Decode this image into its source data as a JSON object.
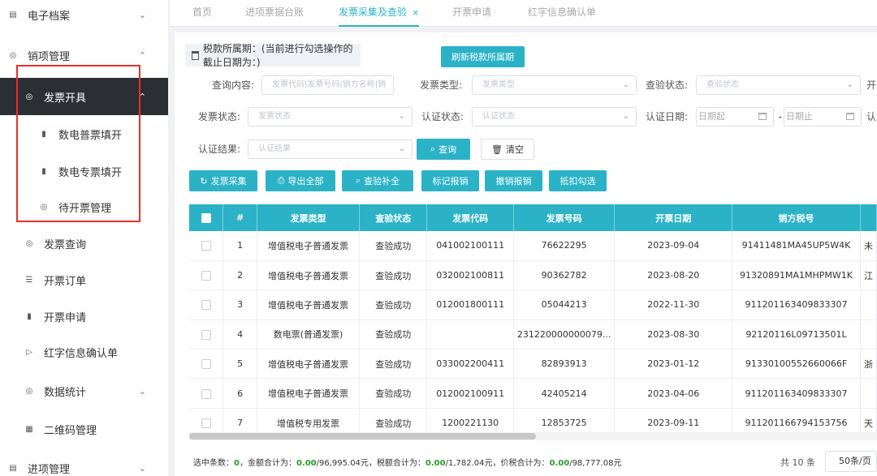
{
  "sidebar": {
    "items": [
      {
        "label": "电子档案",
        "icon": "document-icon",
        "chevron": "⌄"
      },
      {
        "label": "销项管理",
        "icon": "shield-check-icon",
        "chevron": "⌃"
      },
      {
        "label": "发票开具",
        "icon": "shield-check-icon",
        "chevron": "⌃"
      },
      {
        "label": "数电普票填开",
        "icon": "bar-chart-icon",
        "chevron": ""
      },
      {
        "label": "数电专票填开",
        "icon": "bar-chart-icon",
        "chevron": ""
      },
      {
        "label": "待开票管理",
        "icon": "shield-check-icon",
        "chevron": ""
      },
      {
        "label": "发票查询",
        "icon": "shield-check-icon",
        "chevron": ""
      },
      {
        "label": "开票订单",
        "icon": "list-icon",
        "chevron": ""
      },
      {
        "label": "开票申请",
        "icon": "bar-chart-icon",
        "chevron": ""
      },
      {
        "label": "红字信息确认单",
        "icon": "send-icon",
        "chevron": ""
      },
      {
        "label": "数据统计",
        "icon": "shield-check-icon",
        "chevron": "⌄"
      },
      {
        "label": "二维码管理",
        "icon": "qr-code-icon",
        "chevron": ""
      },
      {
        "label": "进项管理",
        "icon": "document-icon",
        "chevron": "⌄"
      }
    ]
  },
  "tabs": [
    {
      "label": "首页"
    },
    {
      "label": "进项票据台账"
    },
    {
      "label": "发票采集及查验",
      "close": "×"
    },
    {
      "label": "开票申请"
    },
    {
      "label": "红字信息确认单"
    }
  ],
  "tax_period": {
    "label": "税款所属期：(当前进行勾选操作的截止日期为：)",
    "refresh_button": "刷新税款所属期"
  },
  "filters": {
    "query_label": "查询内容:",
    "query_placeholder": "发票代码|发票号码|销方名称|销",
    "invoice_type_label": "发票类型:",
    "invoice_type_placeholder": "发票类型",
    "check_status_label": "查验状态:",
    "check_status_placeholder": "查验状态",
    "extra_label_1": "开",
    "invoice_status_label": "发票状态:",
    "invoice_status_placeholder": "发票状态",
    "cert_status_label": "认证状态:",
    "cert_status_placeholder": "认证状态",
    "cert_date_label": "认证日期:",
    "date_start_placeholder": "日期起",
    "date_sep": "-",
    "date_end_placeholder": "日期止",
    "extra_label_2": "认",
    "cert_result_label": "认证结果:",
    "cert_result_placeholder": "认证结果",
    "search_button": "查询",
    "clear_button": "清空"
  },
  "toolbar": {
    "collect": "发票采集",
    "export_all": "导出全部",
    "check_supplement": "查验补全",
    "mark_reimbursed": "标记报销",
    "cancel_reimbursed": "撤销报销",
    "deduct_check": "抵扣勾选"
  },
  "table": {
    "columns": [
      "#",
      "发票类型",
      "查验状态",
      "发票代码",
      "发票号码",
      "开票日期",
      "销方税号"
    ],
    "rows": [
      [
        "1",
        "增值税电子普通发票",
        "查验成功",
        "041002100111",
        "76622295",
        "2023-09-04",
        "91411481MA45UP5W4K"
      ],
      [
        "2",
        "增值税电子普通发票",
        "查验成功",
        "032002100811",
        "90362782",
        "2023-08-20",
        "91320891MA1MHPMW1K"
      ],
      [
        "3",
        "增值税电子普通发票",
        "查验成功",
        "012001800111",
        "05044213",
        "2022-11-30",
        "911201163409833307"
      ],
      [
        "4",
        "数电票(普通发票)",
        "查验成功",
        "",
        "231220000000079...",
        "2023-08-30",
        "92120116L09713501L"
      ],
      [
        "5",
        "增值税电子普通发票",
        "查验成功",
        "033002200411",
        "82893913",
        "2023-01-12",
        "91330100552660066F"
      ],
      [
        "6",
        "增值税电子普通发票",
        "查验成功",
        "012002100911",
        "42405214",
        "2023-04-06",
        "911201163409833307"
      ],
      [
        "7",
        "增值税专用发票",
        "查验成功",
        "1200221130",
        "12853725",
        "2023-09-11",
        "911201166794153756"
      ]
    ],
    "overflow_col": [
      "",
      "未",
      "江",
      "",
      "",
      "浙",
      "",
      "天"
    ]
  },
  "footer": {
    "selected_label": "选中条数：",
    "selected_count": "0",
    "amount_label": "，金额合计为：",
    "amount_selected": "0.00",
    "amount_total": "/96,995.04元",
    "tax_label": "，税额合计为：",
    "tax_selected": "0.00",
    "tax_total": "/1,782.04元",
    "total_label": "，价税合计为：",
    "total_selected": "0.00",
    "total_total": "/98,777.08元",
    "count_text": "共 10 条",
    "page_size": "50条/页"
  }
}
